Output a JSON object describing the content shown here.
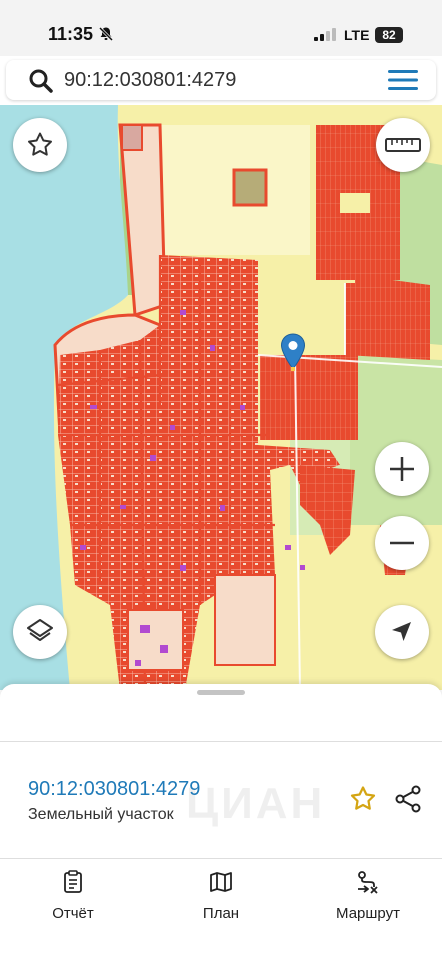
{
  "status_bar": {
    "time": "11:35",
    "carrier": "LTE",
    "battery": "82",
    "icons": [
      "bell-slash-icon",
      "signal-icon",
      "battery-icon"
    ]
  },
  "search": {
    "value": "90:12:030801:4279",
    "icons": [
      "search-icon",
      "menu-icon"
    ]
  },
  "map": {
    "controls": [
      "favorite-star-icon",
      "ruler-icon",
      "zoom-in-icon",
      "zoom-out-icon",
      "layers-icon",
      "locate-arrow-icon"
    ],
    "marker": "location-pin-icon",
    "colors": {
      "sea": "#a8dfe4",
      "land": "#f6f0a8",
      "parcels": "#e84a2e",
      "parcel_light": "#f7dcc9",
      "green": "#c9e4a5",
      "pin": "#2e80c7",
      "purple": "#b24ad0"
    }
  },
  "sheet": {
    "parcel_number": "90:12:030801:4279",
    "parcel_type": "Земельный участок",
    "watermark": "ЦИАН",
    "accent_color": "#1f7ab8",
    "star_color": "#d4a514",
    "icons": [
      "favorite-star-outline-icon",
      "share-icon"
    ]
  },
  "bottom_nav": {
    "items": [
      {
        "label": "Отчёт",
        "icon": "report-clipboard-icon"
      },
      {
        "label": "План",
        "icon": "map-plan-icon"
      },
      {
        "label": "Маршрут",
        "icon": "route-icon"
      }
    ]
  }
}
